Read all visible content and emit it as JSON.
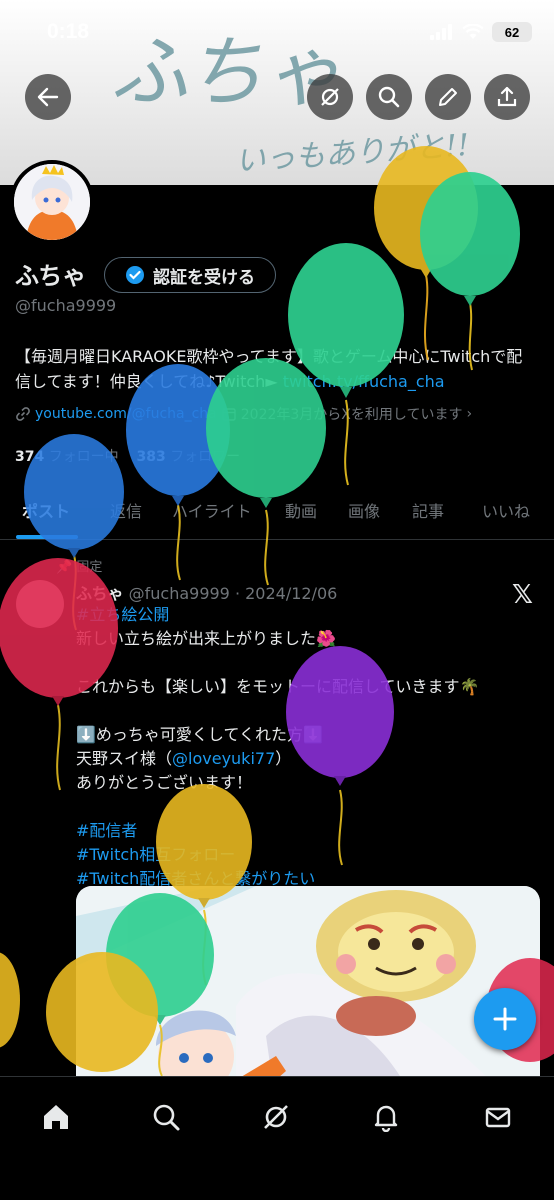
{
  "status_bar": {
    "time": "0:18",
    "battery": "62"
  },
  "banner": {
    "line1": "ふちゃ",
    "line2": "いっもありがと!!"
  },
  "profile": {
    "name": "ふちゃ",
    "verify_label": "認証を受ける",
    "handle": "@fucha9999",
    "bio_text": "【毎週月曜日KARAOKE歌枠やってます】歌とゲーム中心にTwitchで配信してます！仲良くしてね♪Twitch►",
    "bio_link": "twitch.tv/ffucha_cha",
    "meta_link": "youtube.com/@fucha_cha",
    "meta_joined": "2022年3月からXを利用しています",
    "following_count": "374",
    "following_label": "フォロー中",
    "followers_count": "383",
    "followers_label": "フォロワー"
  },
  "tabs": [
    "ポスト",
    "返信",
    "ハイライト",
    "動画",
    "画像",
    "記事",
    "いいね"
  ],
  "post": {
    "pinned_label": "固定",
    "author": "ふちゃ",
    "handle_date": "@fucha9999 · 2024/12/06",
    "hashtag_top": "#立ち絵公開",
    "line1": "新しい立ち絵が出来上がりました🌺",
    "line2": "これからも【楽しい】をモットーに配信していきます🌴",
    "line3": "⬇️めっちゃ可愛くしてくれた方⬇️",
    "line4_prefix": "天野スイ様（",
    "line4_mention": "@loveyuki77",
    "line4_suffix": "）",
    "line5": "ありがとうございます！",
    "tags": [
      "#配信者",
      "#Twitch相互フォロー",
      "#Twitch配信者さんと繋がりたい"
    ]
  },
  "colors": {
    "accent": "#1d9bf0",
    "balloon_yellow": "#e8b820",
    "balloon_green": "#2ecf8f",
    "balloon_blue": "#2a7be0",
    "balloon_red": "#e0284f",
    "balloon_purple": "#8a2fd6"
  }
}
